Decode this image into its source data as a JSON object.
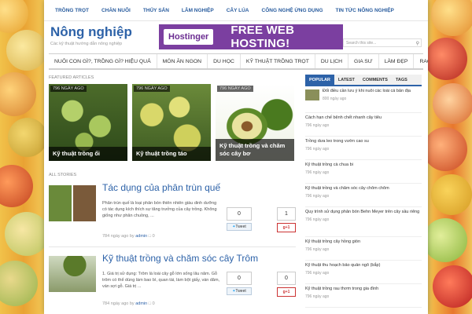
{
  "topnav": [
    "TRỒNG TRỌT",
    "CHĂN NUÔI",
    "THỦY SẢN",
    "LÂM NGHIỆP",
    "CÂY LÚA",
    "CÔNG NGHỆ ỨNG DỤNG",
    "TIN TỨC NÔNG NGHIỆP"
  ],
  "header": {
    "site_title": "Nông nghiệp",
    "tagline": "Các kỹ thuật hướng dẫn nông nghiệp",
    "banner_brand": "Hostinger",
    "banner_promo": "FREE WEB HOSTING!",
    "search_placeholder": "Search this site..."
  },
  "mainnav": [
    "NUÔI CON GÌ?, TRỒNG GÌ? HIỆU QUẢ",
    "MÓN ĂN NGON",
    "DU HỌC",
    "KỸ THUẬT TRỒNG TRỌT",
    "DU LỊCH",
    "GIA SƯ",
    "LÀM ĐẸP",
    "RAO VẶT"
  ],
  "featured": {
    "label": "FEATURED ARTICLES",
    "cards": [
      {
        "badge": "796 NGÀY AGO",
        "caption": "Kỹ thuật trồng ổi"
      },
      {
        "badge": "796 NGÀY AGO",
        "caption": "Kỹ thuật trồng táo"
      },
      {
        "badge": "796 NGÀY AGO",
        "caption": "Kỹ thuật trồng và chăm sóc cây bơ"
      }
    ]
  },
  "stories": {
    "label": "ALL STORIES",
    "items": [
      {
        "title": "Tác dụng của phân trùn quế",
        "excerpt": "Phân trùn quế là loại phân bón thiên nhiên giàu dinh dưỡng có tác dụng kích thích sự tăng trưởng của cây trồng. Không giống như phân chuồng, ...",
        "meta_age": "784 ngày ago",
        "meta_by": "by",
        "meta_author": "admin",
        "meta_comments": "0",
        "share_count": "0",
        "tweet_label": "Tweet",
        "like_count": "1",
        "gplus_label": "+1"
      },
      {
        "title": "Kỹ thuật trồng và chăm sóc cây Trôm",
        "excerpt": "1. Giá trị sử dụng: Trôm là loài cây gỗ lớn sống lâu năm. Gỗ trôm có thể dùng làm bao bì, quan tài, làm bột giấy, ván dăm, ván sợi gỗ. Giá trị ...",
        "meta_age": "784 ngày ago",
        "meta_by": "by",
        "meta_author": "admin",
        "meta_comments": "0",
        "share_count": "0",
        "tweet_label": "Tweet",
        "like_count": "0",
        "gplus_label": "+1"
      }
    ]
  },
  "sidebar": {
    "tabs": [
      "POPULAR",
      "LATEST",
      "COMMENTS",
      "TAGS"
    ],
    "items": [
      {
        "title": "Đối điều cần lưu ý khi nuôi các loài cá bản địa",
        "date": "800 ngày ago"
      },
      {
        "title": "Cách hạn chế bệnh chết nhanh cây tiêu",
        "date": "796 ngày ago"
      },
      {
        "title": "Trồng dưa leo trong vườn cao su",
        "date": "796 ngày ago"
      },
      {
        "title": "Kỹ thuật trồng cà chua bi",
        "date": "796 ngày ago"
      },
      {
        "title": "Kỹ thuật trồng và chăm sóc cây chôm chôm",
        "date": "796 ngày ago"
      },
      {
        "title": "Quy trình sử dụng phân bón Behn Meyer trên cây sầu riêng",
        "date": "796 ngày ago"
      },
      {
        "title": "Kỹ thuật trồng cây hồng giòn",
        "date": "796 ngày ago"
      },
      {
        "title": "Kỹ thuật thu hoạch bảo quản ngô (bắp)",
        "date": "796 ngày ago"
      },
      {
        "title": "Kỹ thuật trồng rau thơm trong gia đình",
        "date": "796 ngày ago"
      }
    ]
  },
  "colors": {
    "accent": "#2d62a8",
    "banner": "#7b3fa0"
  }
}
